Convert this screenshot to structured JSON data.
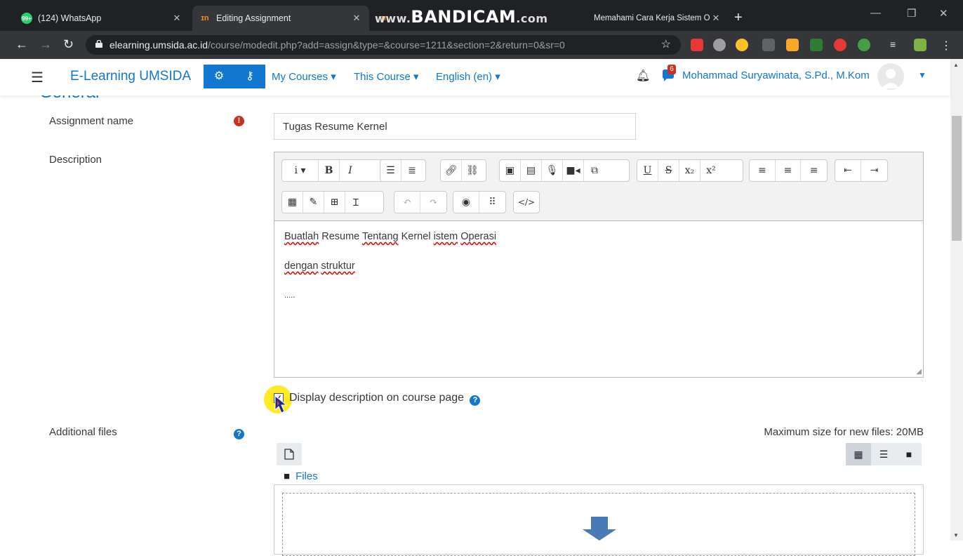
{
  "browser": {
    "tabs": [
      {
        "title": "(124) WhatsApp",
        "icon": "whatsapp-icon",
        "active": false
      },
      {
        "title": "Editing Assignment",
        "icon": "moodle-icon",
        "active": true
      },
      {
        "title": "Memahami Cara Kerja Sistem Op",
        "icon": "moodle-icon",
        "active": false
      }
    ],
    "watermark_prefix": "www.",
    "watermark": "BANDICAM",
    "watermark_suffix": ".com",
    "url_host": "elearning.umsida.ac.id",
    "url_path": "/course/modedit.php?add=assign&type=&course=1211&section=2&return=0&sr=0"
  },
  "navbar": {
    "brand": "E-Learning UMSIDA",
    "my_courses": "My Courses",
    "this_course": "This Course",
    "language": "English (en)",
    "message_count": "6",
    "user_name": "Mohammad Suryawinata, S.Pd., M.Kom"
  },
  "form": {
    "section_title": "General",
    "assignment_name_label": "Assignment name",
    "assignment_name_value": "Tugas Resume Kernel",
    "description_label": "Description",
    "description_lines": [
      "Buatlah Resume Tentang Kernel istem Operasi",
      "dengan struktur",
      "....."
    ],
    "desc_line1_a": "Buatlah",
    "desc_line1_b": " Resume ",
    "desc_line1_c": "Tentang",
    "desc_line1_d": " Kernel ",
    "desc_line1_e": "istem",
    "desc_line1_f": " ",
    "desc_line1_g": "Operasi",
    "desc_line2_a": "dengan",
    "desc_line2_b": " ",
    "desc_line2_c": "struktur",
    "desc_line3": ".....",
    "display_description_label": "Display description on course page",
    "display_description_checked": true,
    "additional_files_label": "Additional files",
    "max_size": "Maximum size for new files: 20MB",
    "files_folder": "Files"
  },
  "editor_toolbar": {
    "row1": [
      "i ▾",
      "B",
      "I",
      "ul",
      "ol",
      "link",
      "unlink",
      "image",
      "media",
      "audio",
      "video",
      "manage",
      "U",
      "S",
      "x₂",
      "x²",
      "left",
      "center",
      "right",
      "outdent",
      "indent"
    ],
    "row2": [
      "equation",
      "char",
      "table",
      "clear",
      "undo",
      "redo",
      "accessibility",
      "screenreader",
      "html"
    ]
  },
  "colors": {
    "accent": "#1177d1",
    "required": "#ca3120",
    "chrome_dark": "#202124",
    "chrome_mid": "#35363a"
  }
}
